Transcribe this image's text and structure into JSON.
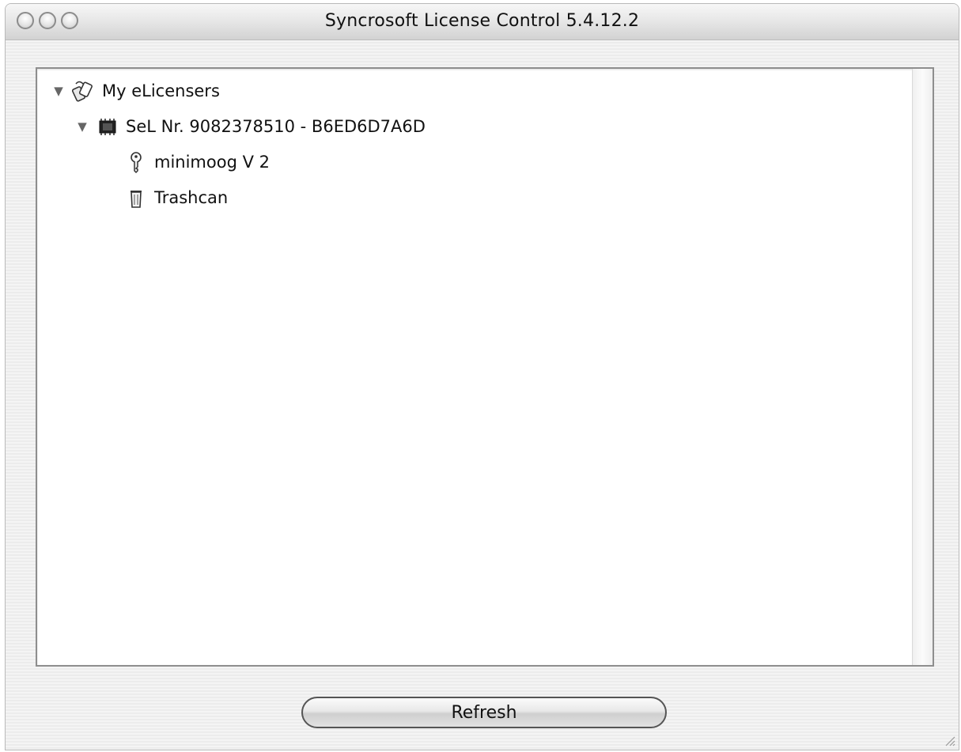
{
  "window": {
    "title": "Syncrosoft License Control 5.4.12.2"
  },
  "tree": {
    "root": {
      "label": "My eLicensers",
      "icon": "elicenser-group-icon",
      "expanded": true
    },
    "dongle": {
      "label": "SeL Nr. 9082378510 - B6ED6D7A6D",
      "icon": "dongle-chip-icon",
      "expanded": true
    },
    "children": [
      {
        "label": "minimoog V 2",
        "icon": "key-icon"
      },
      {
        "label": "Trashcan",
        "icon": "trashcan-icon"
      }
    ]
  },
  "buttons": {
    "refresh_label": "Refresh"
  }
}
